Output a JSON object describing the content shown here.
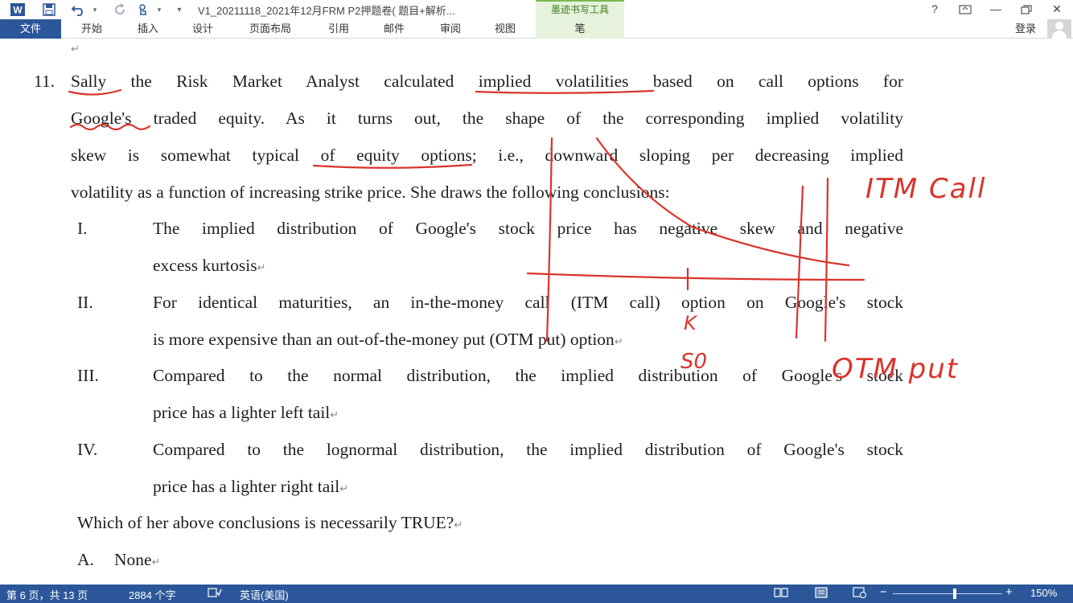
{
  "titlebar": {
    "doc_title": "V1_20211118_2021年12月FRM P2押题卷( 题目+解析...",
    "ctx_tab_group": "墨迹书写工具",
    "help": "?",
    "minimize": "—",
    "close": "✕"
  },
  "ribbon": {
    "file_tab": "文件",
    "tabs": [
      "开始",
      "插入",
      "设计",
      "页面布局",
      "引用",
      "邮件",
      "审阅",
      "视图"
    ],
    "pen_tab": "笔",
    "login": "登录"
  },
  "document": {
    "question_number": "11.",
    "stem_lines": [
      "Sally the Risk Market Analyst calculated implied volatilities based on call options for",
      "Google's traded equity. As it turns out, the shape of the corresponding implied volatility",
      "skew is somewhat typical of equity options; i.e., downward sloping per decreasing implied",
      "volatility as a function of increasing strike price. She draws the following conclusions:"
    ],
    "statements": [
      {
        "numeral": "I.",
        "line1": "The implied distribution of Google's stock price has negative skew and negative",
        "line2": "excess kurtosis"
      },
      {
        "numeral": "II.",
        "line1": "For identical maturities, an in-the-money call (ITM call) option on Google's stock",
        "line2": "is more expensive than an out-of-the-money put (OTM put) option"
      },
      {
        "numeral": "III.",
        "line1": "Compared to the normal distribution, the implied distribution of Google's stock",
        "line2": "price has a lighter left tail"
      },
      {
        "numeral": "IV.",
        "line1": "Compared to the lognormal distribution, the implied distribution of Google's stock",
        "line2": "price has a lighter right tail"
      }
    ],
    "prompt": "Which of her above conclusions is necessarily TRUE?",
    "option_a_letter": "A.",
    "option_a_text": "None",
    "para_mark": "↵",
    "handwriting": {
      "itm_call": "ITM Call",
      "otm_put": "OTM put",
      "k": "K",
      "s0": "S0",
      "ink_color": "#d9342b"
    }
  },
  "statusbar": {
    "page": "第 6 页，共 13 页",
    "words": "2884 个字",
    "language": "英语(美国)",
    "zoom": "150%",
    "zoom_level_percent": 150
  },
  "colors": {
    "accent": "#2b579a",
    "ink_tab": "#e6f2dc"
  }
}
